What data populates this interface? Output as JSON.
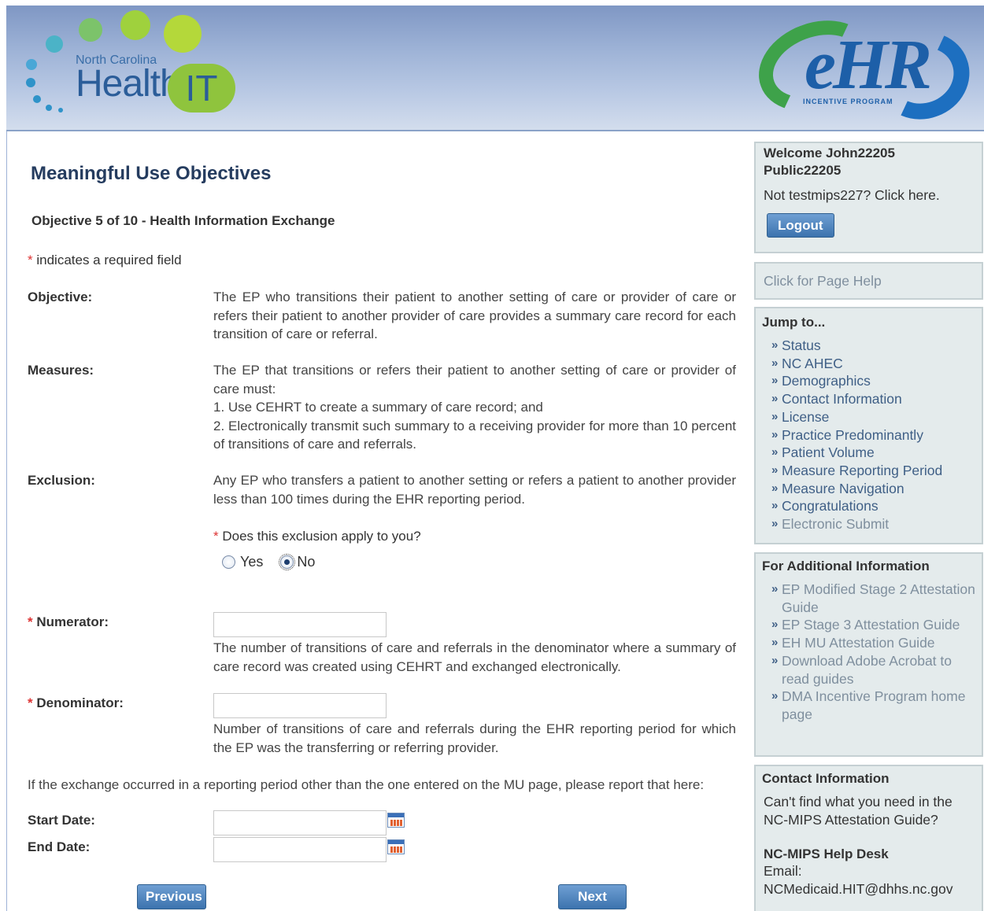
{
  "header": {
    "logo_small": "North Carolina",
    "logo_big": "Health",
    "logo_it": "IT",
    "ehr_logo": "eHR",
    "ehr_sub": "INCENTIVE PROGRAM"
  },
  "main": {
    "title": "Meaningful Use Objectives",
    "subtitle": "Objective 5 of 10 - Health Information Exchange",
    "required_note": "indicates a required field",
    "objective_label": "Objective:",
    "objective_text": "The EP who transitions their patient to another setting of care or provider of care or refers their patient to another provider of care provides a summary care record for each transition of care or referral.",
    "measures_label": "Measures:",
    "measures_intro": "The EP that transitions or refers their patient to another setting of care or provider of care must:",
    "measures_1": "1. Use CEHRT to create a summary of care record; and",
    "measures_2": "2. Electronically transmit such summary to a receiving provider for more than 10 percent of transitions of care and referrals.",
    "exclusion_label": "Exclusion:",
    "exclusion_text": "Any EP who transfers a patient to another setting or refers a patient to another provider less than 100 times during the EHR reporting period.",
    "exclusion_question": "Does this exclusion apply to you?",
    "radio_yes": "Yes",
    "radio_no": "No",
    "radio_selected": "No",
    "numerator_label": "Numerator:",
    "numerator_value": "",
    "numerator_help": "The number of transitions of care and referrals in the denominator where a summary of care record was created using CEHRT and exchanged electronically.",
    "denominator_label": "Denominator:",
    "denominator_value": "",
    "denominator_help": "Number of transitions of care and referrals during the EHR reporting period for which the EP was the transferring or referring provider.",
    "period_note": "If the exchange occurred in a reporting period other than the one entered on the MU page, please report that here:",
    "start_label": "Start Date:",
    "start_value": "",
    "end_label": "End Date:",
    "end_value": "",
    "previous_btn": "Previous",
    "next_btn": "Next"
  },
  "sidebar": {
    "welcome": "Welcome John22205 Public22205",
    "not_user": "Not testmips227? Click here.",
    "logout": "Logout",
    "page_help": "Click for Page Help",
    "jump_title": "Jump to...",
    "jump_items": [
      "Status",
      "NC AHEC",
      "Demographics",
      "Contact Information",
      "License",
      "Practice Predominantly",
      "Patient Volume",
      "Measure Reporting Period",
      "Measure Navigation",
      "Congratulations",
      "Electronic Submit"
    ],
    "info_title": "For Additional Information",
    "info_items": [
      "EP Modified Stage 2 Attestation Guide",
      "EP Stage 3 Attestation Guide",
      "EH MU Attestation Guide",
      "Download Adobe Acrobat to read guides",
      "DMA Incentive Program home page"
    ],
    "contact_title": "Contact Information",
    "contact_text": "Can't find what you need in the NC-MIPS Attestation Guide?",
    "helpdesk_title": "NC-MIPS Help Desk",
    "email_label": "Email:",
    "email": "NCMedicaid.HIT@dhhs.nc.gov"
  }
}
